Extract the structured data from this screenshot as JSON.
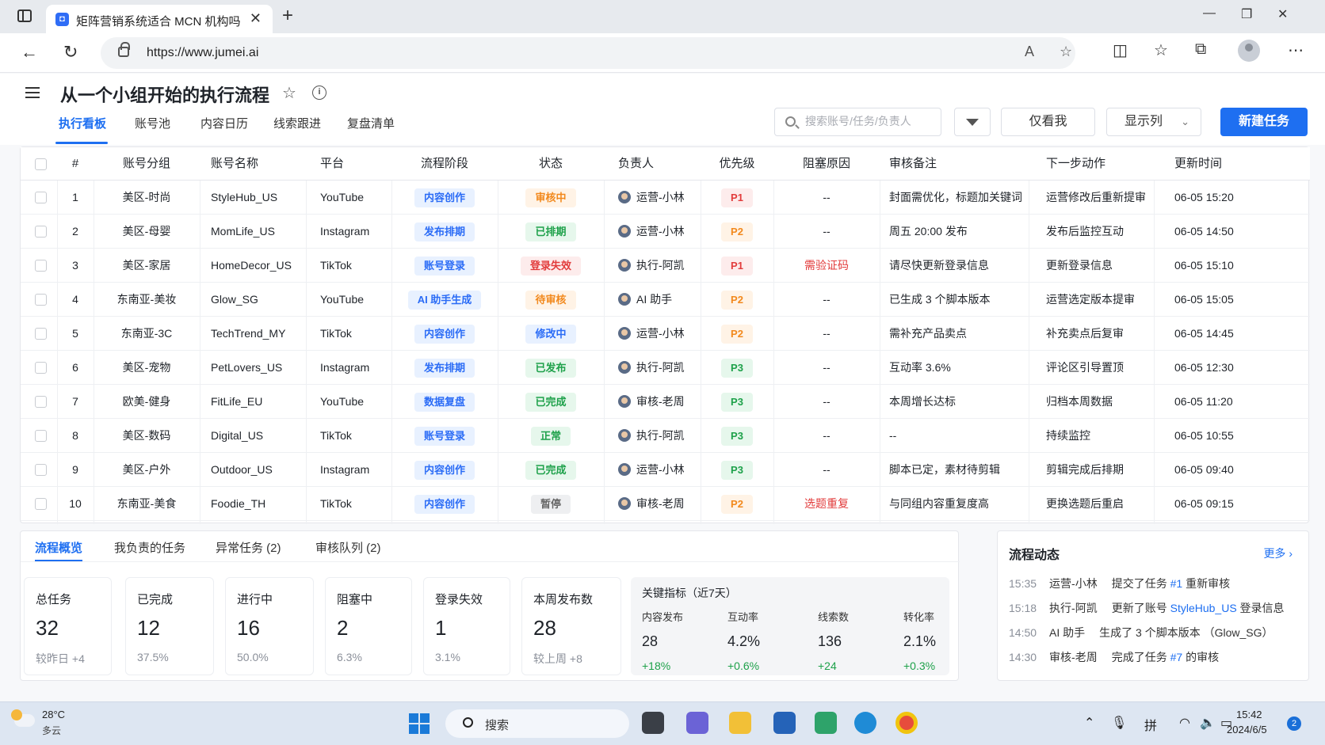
{
  "browser": {
    "tab_title": "矩阵营销系统适合 MCN 机构吗",
    "url": "https://www.jumei.ai",
    "new_tab": "+",
    "close": "✕"
  },
  "header": {
    "title": "从一个小组开始的执行流程",
    "tabs": [
      "执行看板",
      "账号池",
      "内容日历",
      "线索跟进",
      "复盘清单"
    ],
    "search_placeholder": "搜索账号/任务/负责人",
    "btn_only_me": "仅看我",
    "btn_columns": "显示列",
    "btn_new_task": "新建任务"
  },
  "table": {
    "columns": [
      "#",
      "账号分组",
      "账号名称",
      "平台",
      "流程阶段",
      "状态",
      "负责人",
      "优先级",
      "阻塞原因",
      "审核备注",
      "下一步动作",
      "更新时间"
    ],
    "rows": [
      {
        "no": "1",
        "group": "美区-时尚",
        "name": "StyleHub_US",
        "platform": "YouTube",
        "stage": "内容创作",
        "status": "审核中",
        "status_tone": "orange",
        "owner": "运营-小林",
        "priority": "P1",
        "block": "--",
        "note": "封面需优化，标题加关键词",
        "next": "运营修改后重新提审",
        "time": "06-05 15:20"
      },
      {
        "no": "2",
        "group": "美区-母婴",
        "name": "MomLife_US",
        "platform": "Instagram",
        "stage": "发布排期",
        "status": "已排期",
        "status_tone": "green",
        "owner": "运营-小林",
        "priority": "P2",
        "block": "--",
        "note": "周五 20:00 发布",
        "next": "发布后监控互动",
        "time": "06-05 14:50"
      },
      {
        "no": "3",
        "group": "美区-家居",
        "name": "HomeDecor_US",
        "platform": "TikTok",
        "stage": "账号登录",
        "status": "登录失效",
        "status_tone": "red",
        "owner": "执行-阿凯",
        "priority": "P1",
        "block": "需验证码",
        "note": "请尽快更新登录信息",
        "next": "更新登录信息",
        "time": "06-05 15:10"
      },
      {
        "no": "4",
        "group": "东南亚-美妆",
        "name": "Glow_SG",
        "platform": "YouTube",
        "stage": "AI 助手生成",
        "status": "待审核",
        "status_tone": "orange",
        "owner": "AI 助手",
        "priority": "P2",
        "block": "--",
        "note": "已生成 3 个脚本版本",
        "next": "运营选定版本提审",
        "time": "06-05 15:05"
      },
      {
        "no": "5",
        "group": "东南亚-3C",
        "name": "TechTrend_MY",
        "platform": "TikTok",
        "stage": "内容创作",
        "status": "修改中",
        "status_tone": "blue",
        "owner": "运营-小林",
        "priority": "P2",
        "block": "--",
        "note": "需补充产品卖点",
        "next": "补充卖点后复审",
        "time": "06-05 14:45"
      },
      {
        "no": "6",
        "group": "美区-宠物",
        "name": "PetLovers_US",
        "platform": "Instagram",
        "stage": "发布排期",
        "status": "已发布",
        "status_tone": "green",
        "owner": "执行-阿凯",
        "priority": "P3",
        "block": "--",
        "note": "互动率 3.6%",
        "next": "评论区引导置顶",
        "time": "06-05 12:30"
      },
      {
        "no": "7",
        "group": "欧美-健身",
        "name": "FitLife_EU",
        "platform": "YouTube",
        "stage": "数据复盘",
        "status": "已完成",
        "status_tone": "green",
        "owner": "审核-老周",
        "priority": "P3",
        "block": "--",
        "note": "本周增长达标",
        "next": "归档本周数据",
        "time": "06-05 11:20"
      },
      {
        "no": "8",
        "group": "美区-数码",
        "name": "Digital_US",
        "platform": "TikTok",
        "stage": "账号登录",
        "status": "正常",
        "status_tone": "green",
        "owner": "执行-阿凯",
        "priority": "P3",
        "block": "--",
        "note": "--",
        "next": "持续监控",
        "time": "06-05 10:55"
      },
      {
        "no": "9",
        "group": "美区-户外",
        "name": "Outdoor_US",
        "platform": "Instagram",
        "stage": "内容创作",
        "status": "已完成",
        "status_tone": "green",
        "owner": "运营-小林",
        "priority": "P3",
        "block": "--",
        "note": "脚本已定，素材待剪辑",
        "next": "剪辑完成后排期",
        "time": "06-05 09:40"
      },
      {
        "no": "10",
        "group": "东南亚-美食",
        "name": "Foodie_TH",
        "platform": "TikTok",
        "stage": "内容创作",
        "status": "暂停",
        "status_tone": "gray",
        "owner": "审核-老周",
        "priority": "P2",
        "block": "选题重复",
        "note": "与同组内容重复度高",
        "next": "更换选题后重启",
        "time": "06-05 09:15"
      }
    ]
  },
  "overview": {
    "tabs": [
      "流程概览",
      "我负责的任务",
      "异常任务 (2)",
      "审核队列 (2)"
    ],
    "stats": [
      {
        "label": "总任务",
        "value": "32",
        "sub": "较昨日 +4"
      },
      {
        "label": "已完成",
        "value": "12",
        "sub": "37.5%"
      },
      {
        "label": "进行中",
        "value": "16",
        "sub": "50.0%"
      },
      {
        "label": "阻塞中",
        "value": "2",
        "sub": "6.3%"
      },
      {
        "label": "登录失效",
        "value": "1",
        "sub": "3.1%"
      },
      {
        "label": "本周发布数",
        "value": "28",
        "sub": "较上周 +8"
      }
    ],
    "kpi_title": "关键指标（近7天）",
    "kpis": [
      {
        "label": "内容发布",
        "value": "28",
        "delta": "+18%"
      },
      {
        "label": "互动率",
        "value": "4.2%",
        "delta": "+0.6%"
      },
      {
        "label": "线索数",
        "value": "136",
        "delta": "+24"
      },
      {
        "label": "转化率",
        "value": "2.1%",
        "delta": "+0.3%"
      }
    ]
  },
  "activity": {
    "title": "流程动态",
    "more": "更多 ›",
    "items": [
      {
        "time": "15:35",
        "who": "运营-小林",
        "pre": "提交了任务 ",
        "link": "#1",
        "post": " 重新审核"
      },
      {
        "time": "15:18",
        "who": "执行-阿凯",
        "pre": "更新了账号 ",
        "link": "StyleHub_US",
        "post": " 登录信息"
      },
      {
        "time": "14:50",
        "who": "AI 助手",
        "pre": "生成了 3 个脚本版本 （Glow_SG）",
        "link": "",
        "post": ""
      },
      {
        "time": "14:30",
        "who": "审核-老周",
        "pre": "完成了任务 ",
        "link": "#7",
        "post": " 的审核"
      }
    ]
  },
  "taskbar": {
    "temp": "28°C",
    "weather": "多云",
    "search": "搜索",
    "time": "15:42",
    "date": "2024/6/5",
    "ime": "拼",
    "notif": "2"
  },
  "colors": {
    "accent": "#1e6ff1",
    "danger": "#e23c3c",
    "warning": "#f2891d",
    "success": "#1ea14a"
  }
}
